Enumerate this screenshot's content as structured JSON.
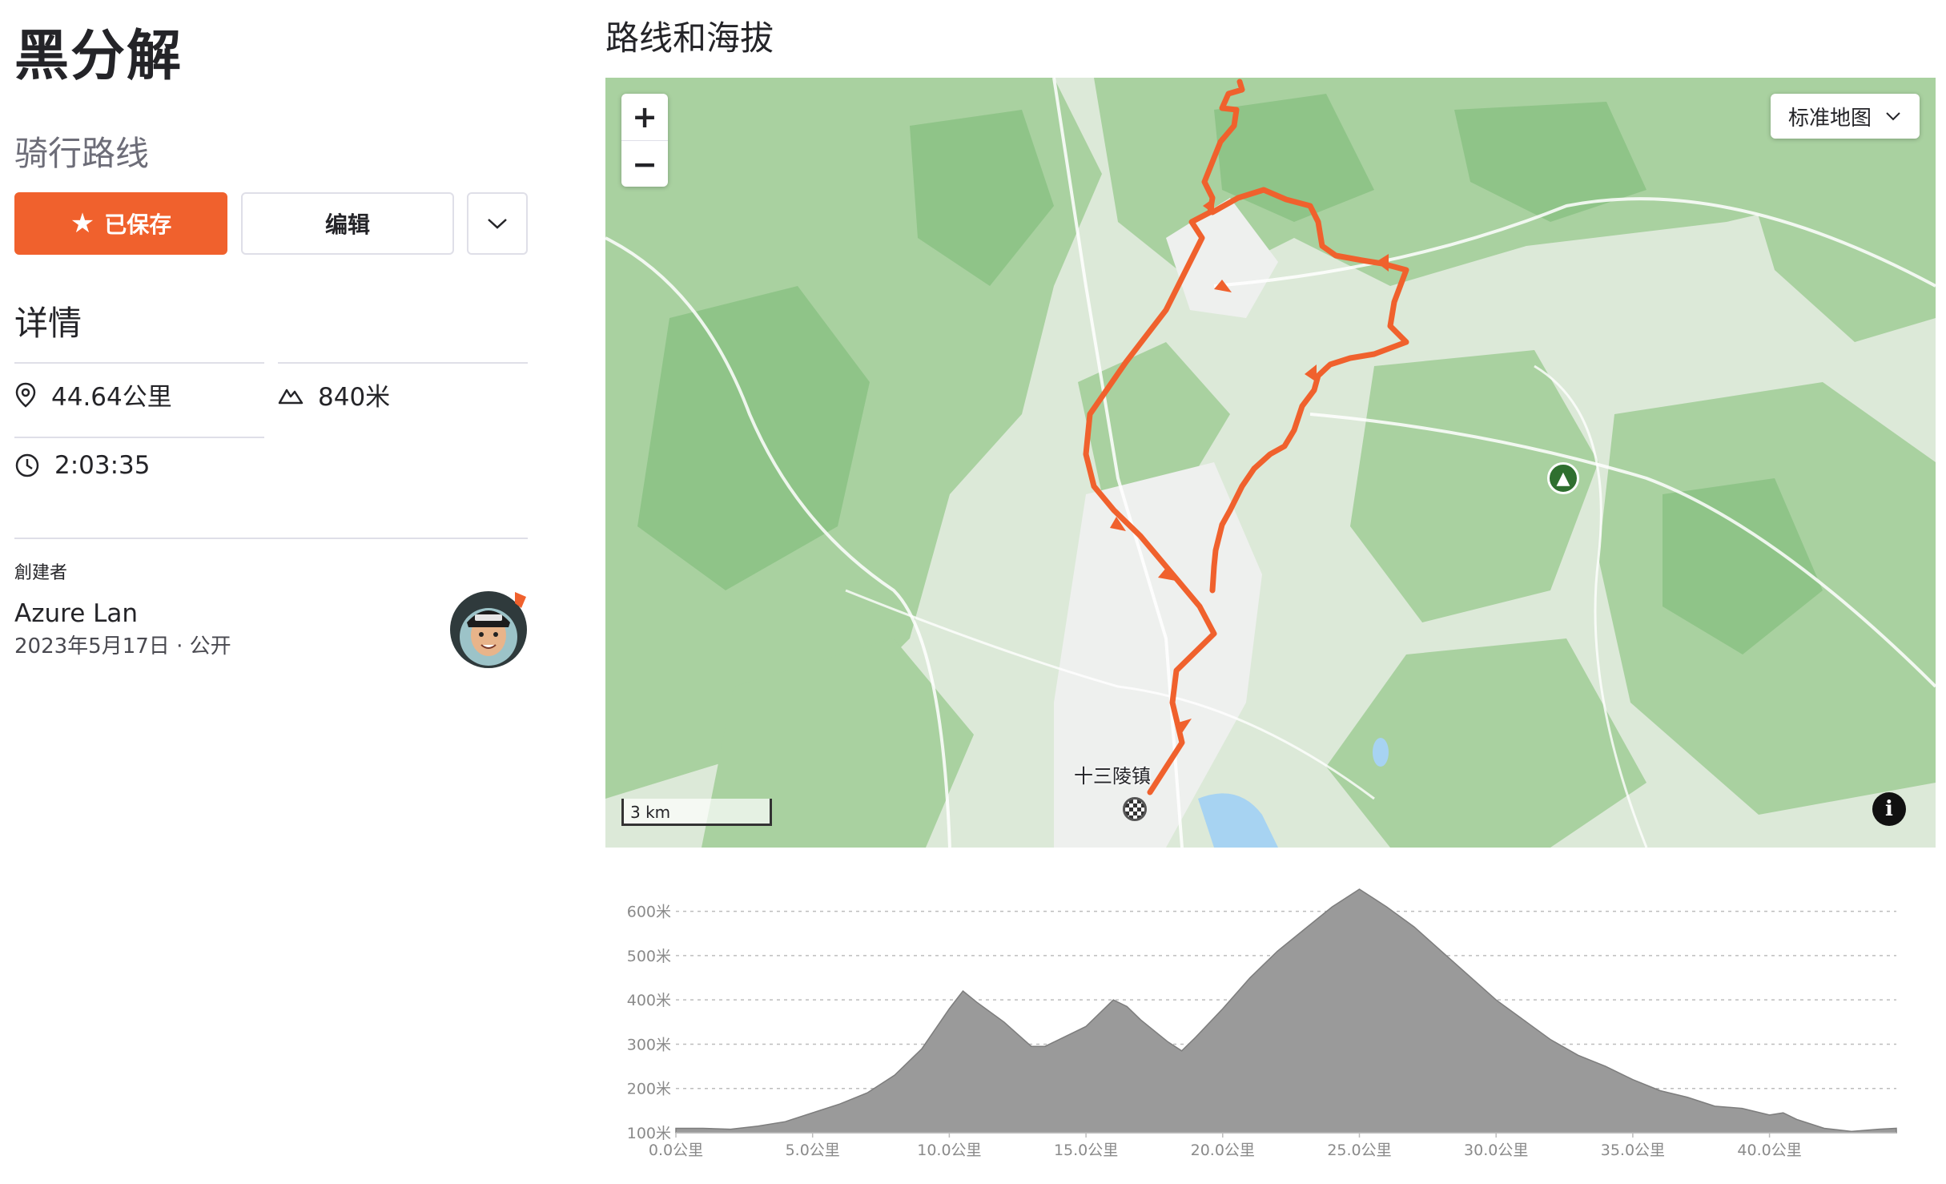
{
  "route": {
    "title": "黑分解",
    "type": "骑行路线"
  },
  "actions": {
    "saved_label": "已保存",
    "edit_label": "编辑"
  },
  "details": {
    "heading": "详情",
    "distance": "44.64公里",
    "elevation_gain": "840米",
    "moving_time": "2:03:35"
  },
  "creator": {
    "label": "創建者",
    "name": "Azure Lan",
    "date": "2023年5月17日",
    "visibility": "公开"
  },
  "map": {
    "section_title": "路线和海拔",
    "zoom_in": "+",
    "zoom_out": "−",
    "map_type": "标准地图",
    "scale_label": "3 km",
    "town_label": "十三陵镇",
    "info": "i",
    "route_color": "#f0612d"
  },
  "chart_data": {
    "type": "area",
    "title": "",
    "xlabel": "",
    "ylabel": "",
    "x_unit": "公里",
    "y_unit": "米",
    "xlim": [
      0,
      44.64
    ],
    "ylim": [
      100,
      650
    ],
    "x_ticks": [
      "0.0公里",
      "5.0公里",
      "10.0公里",
      "15.0公里",
      "20.0公里",
      "25.0公里",
      "30.0公里",
      "35.0公里",
      "40.0公里"
    ],
    "y_ticks": [
      "100米",
      "200米",
      "300米",
      "400米",
      "500米",
      "600米"
    ],
    "grid": "horizontal dashed",
    "color": "#9a9a9a",
    "x": [
      0,
      1,
      2,
      3,
      4,
      5,
      6,
      7,
      8,
      9,
      10,
      10.5,
      11,
      12,
      13,
      13.5,
      14,
      15,
      16,
      16.5,
      17,
      18,
      18.5,
      19,
      20,
      21,
      22,
      23,
      24,
      25,
      25.5,
      26,
      27,
      28,
      29,
      30,
      31,
      32,
      33,
      34,
      35,
      36,
      37,
      38,
      39,
      40,
      40.5,
      41,
      42,
      43,
      44,
      44.64
    ],
    "y": [
      110,
      110,
      108,
      115,
      125,
      145,
      165,
      190,
      230,
      290,
      380,
      420,
      395,
      350,
      295,
      295,
      310,
      340,
      400,
      385,
      355,
      305,
      285,
      315,
      380,
      450,
      510,
      560,
      610,
      650,
      630,
      610,
      565,
      510,
      455,
      400,
      355,
      310,
      275,
      250,
      220,
      195,
      180,
      160,
      155,
      140,
      145,
      130,
      110,
      103,
      108,
      110
    ]
  }
}
